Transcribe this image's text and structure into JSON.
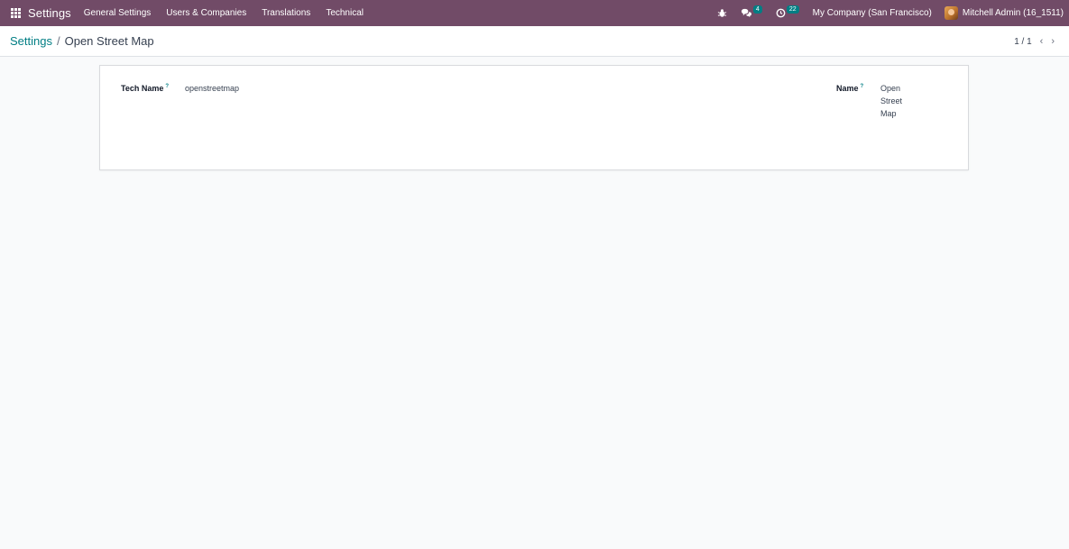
{
  "navbar": {
    "brand": "Settings",
    "menu": [
      "General Settings",
      "Users & Companies",
      "Translations",
      "Technical"
    ],
    "messages_count": "4",
    "activities_count": "22",
    "company": "My Company (San Francisco)",
    "user": "Mitchell Admin (16_1511)"
  },
  "breadcrumb": {
    "parent": "Settings",
    "separator": "/",
    "current": "Open Street Map"
  },
  "pager": {
    "value": "1 / 1",
    "prev": "‹",
    "next": "›"
  },
  "form": {
    "tech_name_label": "Tech Name",
    "tech_name_help": "?",
    "tech_name_value": "openstreetmap",
    "name_label": "Name",
    "name_help": "?",
    "name_value": "Open Street Map"
  },
  "colors": {
    "navbar": "#714b67",
    "accent": "#017e84"
  }
}
